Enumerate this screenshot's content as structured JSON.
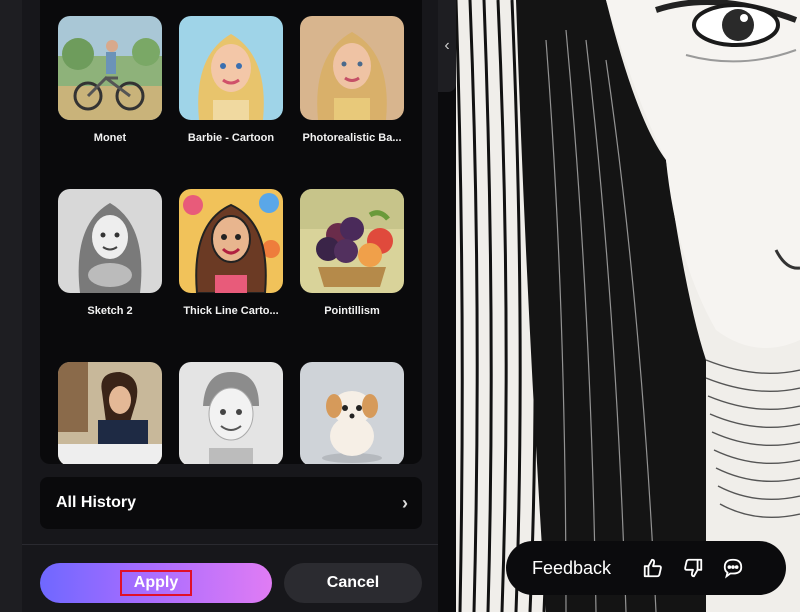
{
  "styles": [
    {
      "label": "Monet"
    },
    {
      "label": "Barbie - Cartoon"
    },
    {
      "label": "Photorealistic Ba..."
    },
    {
      "label": "Sketch 2"
    },
    {
      "label": "Thick Line Carto..."
    },
    {
      "label": "Pointillism"
    },
    {
      "label": ""
    },
    {
      "label": ""
    },
    {
      "label": ""
    }
  ],
  "history": {
    "label": "All History",
    "icon": "chevron-right-icon"
  },
  "actions": {
    "apply_label": "Apply",
    "cancel_label": "Cancel"
  },
  "panel_toggle": {
    "icon": "chevron-left-icon"
  },
  "feedback": {
    "label": "Feedback",
    "icons": [
      "thumbs-up-icon",
      "thumbs-down-icon",
      "chat-bubble-icon"
    ]
  },
  "colors": {
    "accent_gradient": [
      "#6f68ff",
      "#a76cff",
      "#e07cf4"
    ],
    "panel_bg": "#17171b",
    "highlight_border": "#e0102a"
  }
}
